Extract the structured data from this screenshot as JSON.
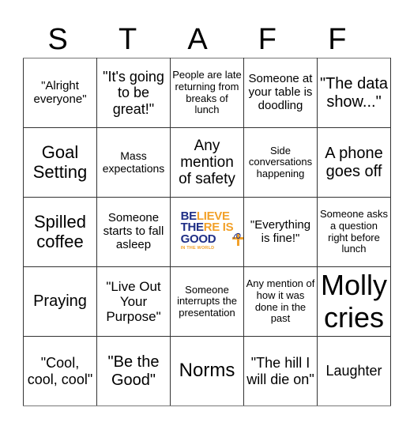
{
  "title_letters": [
    "S",
    "T",
    "A",
    "F",
    "F"
  ],
  "board": {
    "rows": [
      [
        {
          "text": "\"Alright everyone\""
        },
        {
          "text": "\"It's going to be great!\""
        },
        {
          "text": "People are late returning from breaks of lunch"
        },
        {
          "text": "Someone at your table is doodling"
        },
        {
          "text": "\"The data show...\""
        }
      ],
      [
        {
          "text": "Goal Setting"
        },
        {
          "text": "Mass expectations"
        },
        {
          "text": "Any mention of safety"
        },
        {
          "text": "Side conversations happening"
        },
        {
          "text": "A phone goes off"
        }
      ],
      [
        {
          "text": "Spilled coffee"
        },
        {
          "text": "Someone starts to fall asleep"
        },
        {
          "free_space": true,
          "logo": {
            "line1_a": "BE",
            "line1_b": "LIEVE",
            "line2_a": "THE",
            "line2_b": "RE IS",
            "line3_a": "GOOD",
            "tagline": "IN THE WORLD",
            "colors": {
              "navy": "#1f2f86",
              "gold": "#f2a12a"
            }
          }
        },
        {
          "text": "\"Everything is fine!\""
        },
        {
          "text": "Someone asks a question right before lunch"
        }
      ],
      [
        {
          "text": "Praying"
        },
        {
          "text": "\"Live Out Your Purpose\""
        },
        {
          "text": "Someone interrupts the presentation"
        },
        {
          "text": "Any mention of how it was done in the past"
        },
        {
          "text": "Molly cries"
        }
      ],
      [
        {
          "text": "\"Cool, cool, cool\""
        },
        {
          "text": "\"Be the Good\""
        },
        {
          "text": "Norms"
        },
        {
          "text": "\"The hill I will die on\""
        },
        {
          "text": "Laughter"
        }
      ]
    ]
  }
}
